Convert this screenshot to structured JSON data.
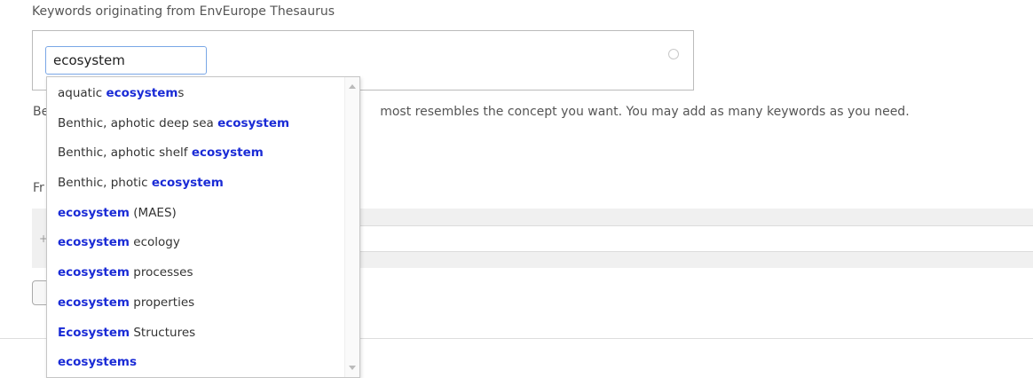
{
  "section": {
    "label": "Keywords originating from EnvEurope Thesaurus"
  },
  "search": {
    "value": "ecosystem"
  },
  "help": {
    "prefix": "Be",
    "suffix": "most resembles the concept you want. You may add as many keywords as you need."
  },
  "fragment": {
    "label": "Fr",
    "plus": "+"
  },
  "suggestions": [
    {
      "pre": "aquatic ",
      "match": "ecosystem",
      "post": "s"
    },
    {
      "pre": "Benthic, aphotic deep sea ",
      "match": "ecosystem",
      "post": ""
    },
    {
      "pre": "Benthic, aphotic shelf ",
      "match": "ecosystem",
      "post": ""
    },
    {
      "pre": "Benthic, photic ",
      "match": "ecosystem",
      "post": ""
    },
    {
      "pre": "",
      "match": "ecosystem",
      "post": " (MAES)"
    },
    {
      "pre": "",
      "match": "ecosystem",
      "post": " ecology"
    },
    {
      "pre": "",
      "match": "ecosystem",
      "post": " processes"
    },
    {
      "pre": "",
      "match": "ecosystem",
      "post": " properties"
    },
    {
      "pre": "",
      "match": "Ecosystem",
      "post": " Structures"
    },
    {
      "pre": "",
      "match": "ecosystems",
      "post": ""
    }
  ],
  "colors": {
    "highlight": "#1a2bd6",
    "input_border": "#7aa7e6"
  },
  "icons": {
    "loading": "spinner-icon",
    "scroll_up": "scroll-up-icon",
    "scroll_down": "scroll-down-icon"
  }
}
